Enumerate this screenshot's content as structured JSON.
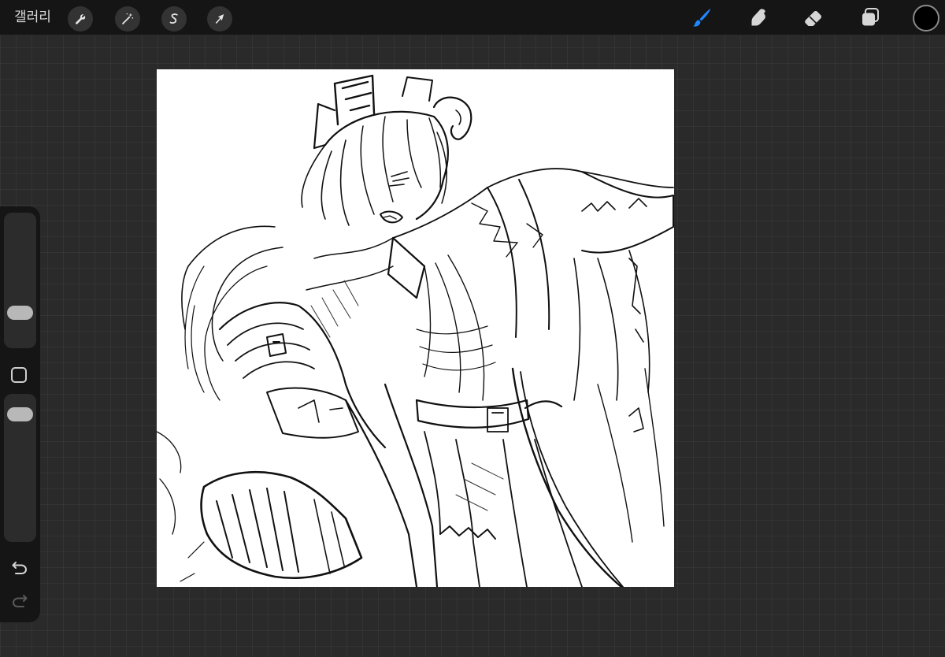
{
  "toolbar": {
    "gallery_label": "갤러리",
    "left_tools": [
      {
        "name": "actions",
        "icon": "wrench-icon"
      },
      {
        "name": "adjustments",
        "icon": "magic-wand-icon"
      },
      {
        "name": "selection",
        "icon": "selection-s-icon"
      },
      {
        "name": "transform",
        "icon": "arrow-cursor-icon"
      }
    ],
    "right_tools": [
      {
        "name": "brush",
        "icon": "brush-icon",
        "active": true
      },
      {
        "name": "smudge",
        "icon": "smudge-finger-icon",
        "active": false
      },
      {
        "name": "eraser",
        "icon": "eraser-icon",
        "active": false
      },
      {
        "name": "layers",
        "icon": "layers-icon",
        "active": false
      }
    ],
    "current_color": "#000000"
  },
  "sidebar": {
    "size_slider_icon": "brush-size-slider",
    "modify_button_icon": "square-outline-icon",
    "opacity_slider_icon": "opacity-slider",
    "undo_icon": "undo-arrow-icon",
    "redo_icon": "redo-arrow-icon"
  },
  "canvas": {
    "background_color": "#ffffff",
    "content": "pencil-sketch-artwork"
  },
  "colors": {
    "accent": "#1e88ff",
    "toolbar_bg": "#151515",
    "workspace_bg": "#2a2a2a"
  }
}
